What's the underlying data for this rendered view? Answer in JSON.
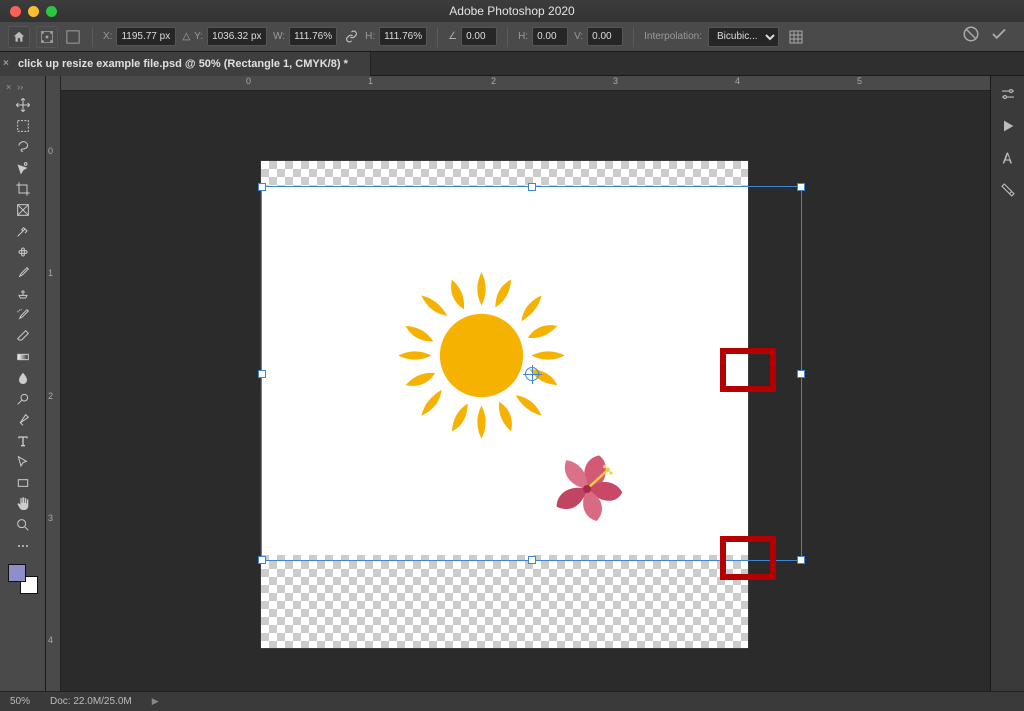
{
  "app_title": "Adobe Photoshop 2020",
  "document_tab": "click up resize example file.psd @ 50% (Rectangle 1, CMYK/8) *",
  "options_bar": {
    "x": "1195.77 px",
    "y": "1036.32 px",
    "w": "111.76%",
    "h": "111.76%",
    "angle": "0.00",
    "skew_h": "0.00",
    "skew_v": "0.00",
    "interpolation_label": "Interpolation:",
    "interpolation_value": "Bicubic..."
  },
  "ruler_h_labels": [
    "0",
    "1",
    "2",
    "3",
    "4",
    "5"
  ],
  "ruler_v_labels": [
    "0",
    "1",
    "2",
    "3",
    "4"
  ],
  "status": {
    "zoom": "50%",
    "doc": "Doc: 22.0M/25.0M"
  },
  "tools": [
    "move",
    "marquee",
    "lasso",
    "quick-select",
    "crop",
    "frame",
    "eyedropper",
    "spot-heal",
    "brush",
    "clone-stamp",
    "history-brush",
    "eraser",
    "gradient",
    "blur",
    "dodge",
    "pen",
    "type",
    "path-select",
    "rectangle",
    "hand",
    "zoom",
    "more"
  ]
}
